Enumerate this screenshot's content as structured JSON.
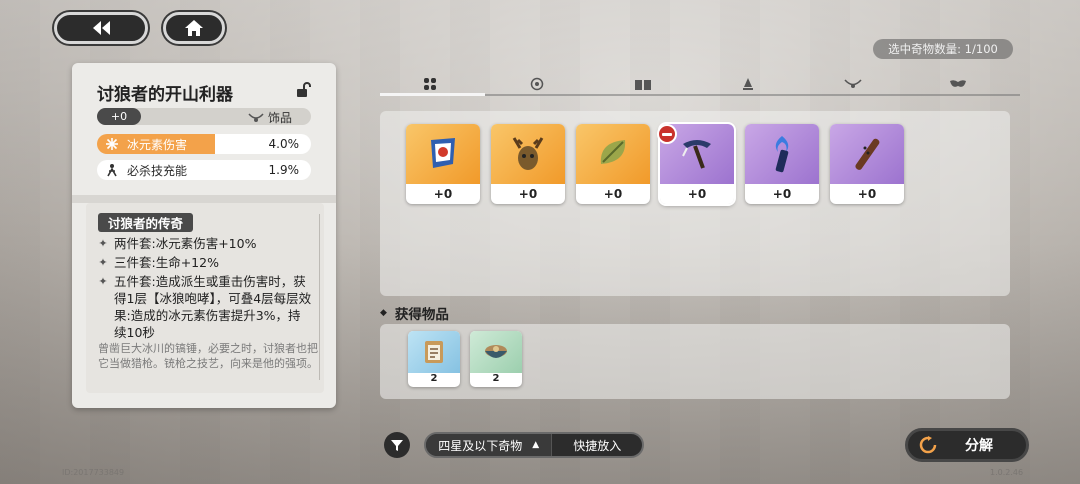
{
  "header": {
    "back_icon": "double-chevron-left-icon",
    "home_icon": "home-icon",
    "selection_count": "选中奇物数量: 1/100"
  },
  "detail": {
    "title": "讨狼者的开山利器",
    "lock_icon": "unlock-icon",
    "level": "+0",
    "type_label": "饰品",
    "stats": [
      {
        "icon": "snowflake-icon",
        "name": "冰元素伤害",
        "value": "4.0%"
      },
      {
        "icon": "figure-icon",
        "name": "必杀技充能",
        "value": "1.9%"
      }
    ],
    "set_name": "讨狼者的传奇",
    "set_bonuses": [
      {
        "text": "两件套:冰元素伤害+10%"
      },
      {
        "text": "三件套:生命+12%"
      },
      {
        "text": "五件套:造成派生或重击伤害时，获得1层【冰狼咆哮】，可叠4层每层效果:造成的冰元素伤害提升3%，持续10秒"
      }
    ],
    "flavor": "曾凿巨大冰川的镐锤，必要之时，讨狼者也把它当做猎枪。铳枪之技艺，向来是他的强项。"
  },
  "tabs": [
    {
      "icon": "grid-icon",
      "active": true
    },
    {
      "icon": "gear-round-icon",
      "active": false
    },
    {
      "icon": "book-icon",
      "active": false
    },
    {
      "icon": "bell-icon",
      "active": false
    },
    {
      "icon": "necklace-icon",
      "active": false
    },
    {
      "icon": "mask-icon",
      "active": false
    }
  ],
  "items": [
    {
      "level": "+0",
      "rarity": "gold",
      "icon": "flag-icon"
    },
    {
      "level": "+0",
      "rarity": "gold",
      "icon": "antler-mask-icon"
    },
    {
      "level": "+0",
      "rarity": "gold",
      "icon": "leaf-icon"
    },
    {
      "level": "+0",
      "rarity": "purple",
      "icon": "pickaxe-icon",
      "selected": true
    },
    {
      "level": "+0",
      "rarity": "purple",
      "icon": "torch-icon"
    },
    {
      "level": "+0",
      "rarity": "purple",
      "icon": "flute-icon"
    }
  ],
  "obtained": {
    "label": "获得物品",
    "materials": [
      {
        "count": "2",
        "icon": "clipboard-icon"
      },
      {
        "count": "2",
        "icon": "bowl-icon"
      }
    ]
  },
  "bottom": {
    "filter_icon": "funnel-icon",
    "filter_label": "四星及以下奇物",
    "quick_add_label": "快捷放入",
    "decompose_label": "分解"
  },
  "footer": {
    "id_text": "ID:2017733849",
    "version": "1.0.2.46"
  },
  "colors": {
    "accent_orange": "#f3a24a",
    "rarity_gold": "#f19a2a",
    "rarity_purple": "#9c73cf",
    "remove_red": "#c9322c"
  }
}
